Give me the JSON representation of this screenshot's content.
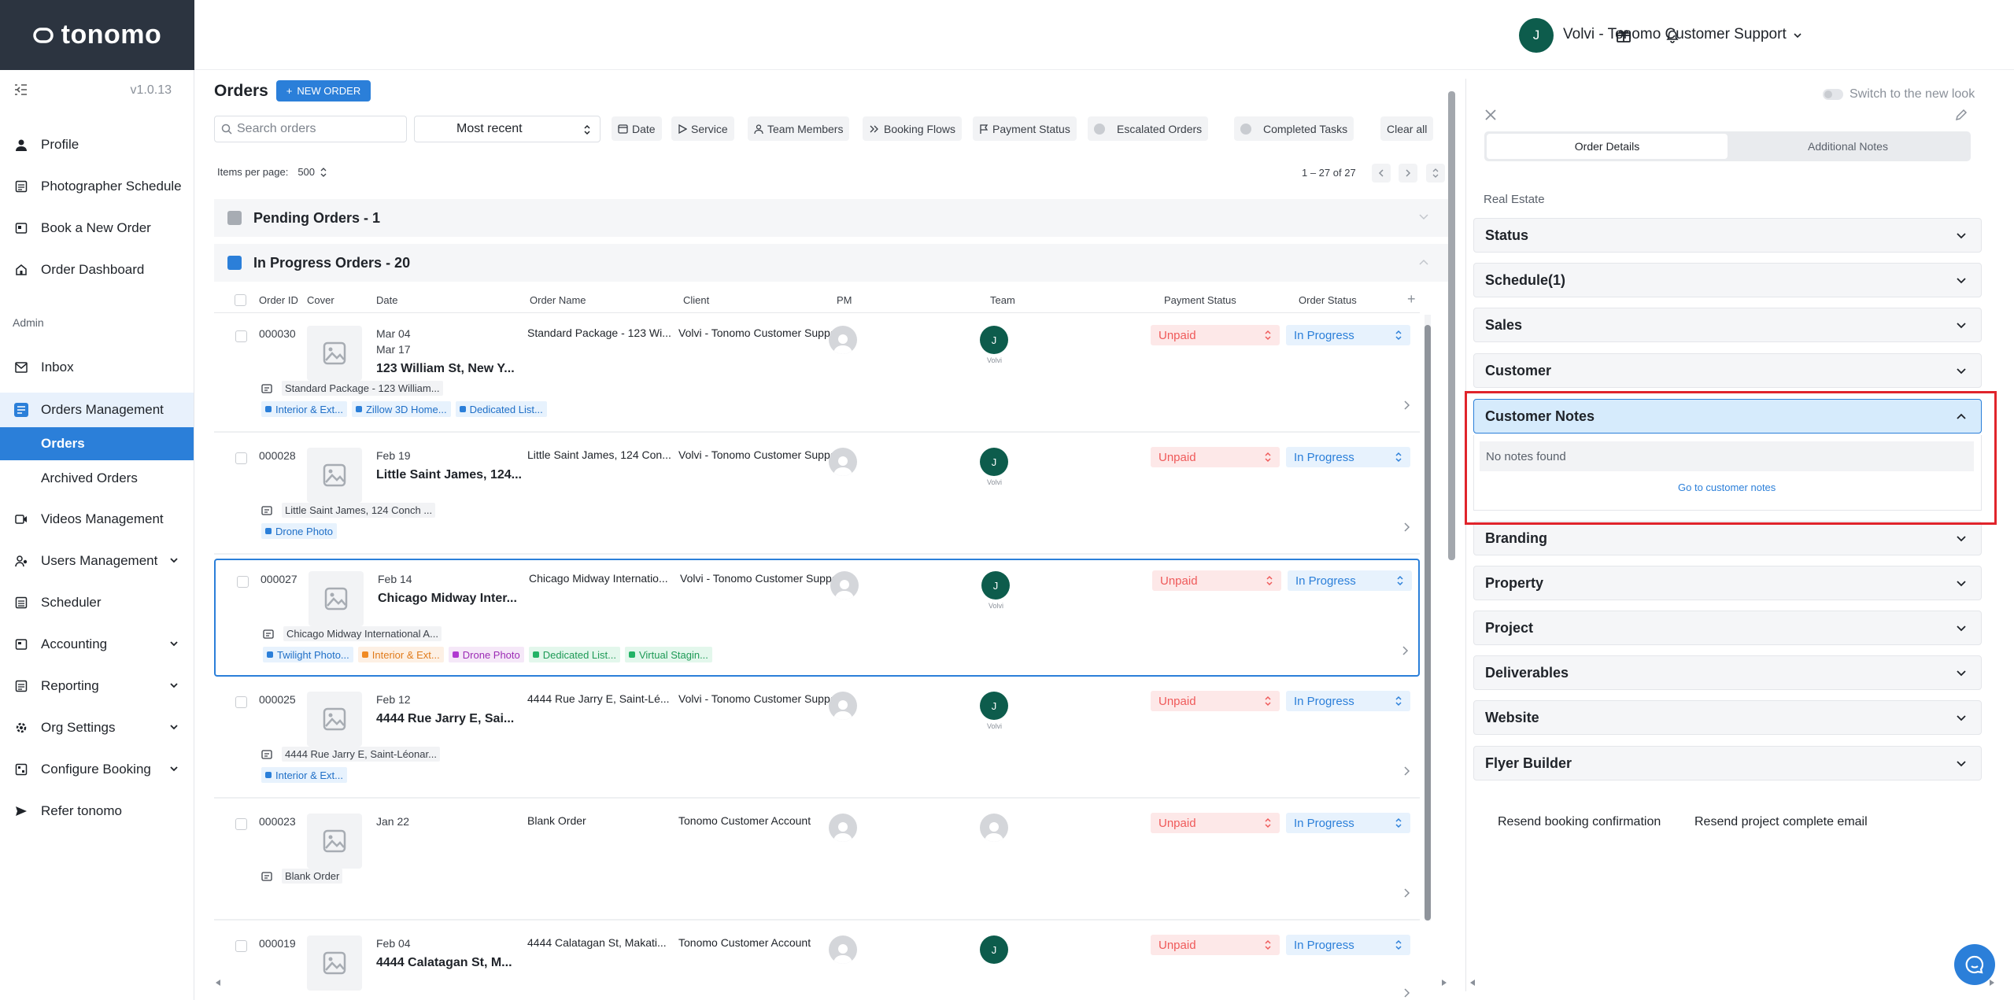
{
  "app": {
    "logo": "tonomo",
    "version": "v1.0.13"
  },
  "colors": {
    "brand_dark": "#2c3440",
    "accent": "#2b7fd9",
    "avatar_green": "#0d5c4c",
    "unpaid_red": "#ef5a5a",
    "highlight_red": "#e0242b"
  },
  "sidebar": {
    "items": [
      {
        "label": "Profile",
        "icon": "person-icon"
      },
      {
        "label": "Photographer Schedule",
        "icon": "schedule-icon"
      },
      {
        "label": "Book a New Order",
        "icon": "book-icon"
      },
      {
        "label": "Order Dashboard",
        "icon": "home-icon"
      }
    ],
    "admin_label": "Admin",
    "admin_items": [
      {
        "label": "Inbox",
        "icon": "mail-icon"
      },
      {
        "label": "Orders Management",
        "icon": "orders-icon"
      },
      {
        "label": "Videos Management",
        "icon": "video-icon"
      },
      {
        "label": "Users Management",
        "icon": "users-icon"
      },
      {
        "label": "Scheduler",
        "icon": "scheduler-icon"
      },
      {
        "label": "Accounting",
        "icon": "accounting-icon"
      },
      {
        "label": "Reporting",
        "icon": "reporting-icon"
      },
      {
        "label": "Org Settings",
        "icon": "gear-icon"
      },
      {
        "label": "Configure Booking",
        "icon": "booking-icon"
      },
      {
        "label": "Refer tonomo",
        "icon": "send-icon"
      }
    ],
    "sub_items": {
      "orders": "Orders",
      "archived": "Archived Orders"
    }
  },
  "topbar": {
    "user_initial": "J",
    "user_name": "Volvi - Tonomo Customer Support"
  },
  "orders": {
    "title": "Orders",
    "new_order_label": "NEW ORDER",
    "search_placeholder": "Search orders",
    "sort_value": "Most recent",
    "filters": [
      "Date",
      "Service",
      "Team Members",
      "Booking Flows",
      "Payment Status",
      "Escalated Orders",
      "Completed Tasks",
      "Clear all"
    ],
    "items_per_page_label": "Items per page:",
    "items_per_page_value": "500",
    "pager_range": "1 – 27 of 27",
    "sections": {
      "pending": "Pending Orders - 1",
      "in_progress": "In Progress Orders - 20"
    },
    "columns": [
      "Order ID",
      "Cover",
      "Date",
      "Order Name",
      "Client",
      "PM",
      "Team",
      "Payment Status",
      "Order Status"
    ],
    "rows": [
      {
        "id": "000030",
        "date1": "Mar 04",
        "date2": "Mar 17",
        "address": "123 William St, New Y...",
        "name": "Standard Package - 123 Wi...",
        "client": "Volvi - Tonomo Customer Support",
        "team_initial": "J",
        "team_label": "Volvi",
        "payment": "Unpaid",
        "status": "In Progress",
        "note": "Standard Package - 123 William...",
        "tags": [
          {
            "label": "Interior & Ext...",
            "color": "blue"
          },
          {
            "label": "Zillow 3D Home...",
            "color": "blue"
          },
          {
            "label": "Dedicated List...",
            "color": "blue"
          }
        ]
      },
      {
        "id": "000028",
        "date1": "Feb 19",
        "date2": "",
        "address": "Little Saint James, 124...",
        "name": "Little Saint James, 124 Con...",
        "client": "Volvi - Tonomo Customer Support",
        "team_initial": "J",
        "team_label": "Volvi",
        "payment": "Unpaid",
        "status": "In Progress",
        "note": "Little Saint James, 124 Conch ...",
        "tags": [
          {
            "label": "Drone Photo",
            "color": "blue"
          }
        ]
      },
      {
        "id": "000027",
        "date1": "Feb 14",
        "date2": "",
        "address": "Chicago Midway Inter...",
        "name": "Chicago Midway Internatio...",
        "client": "Volvi - Tonomo Customer Support",
        "team_initial": "J",
        "team_label": "Volvi",
        "payment": "Unpaid",
        "status": "In Progress",
        "note": "Chicago Midway International A...",
        "tags": [
          {
            "label": "Twilight Photo...",
            "color": "blue"
          },
          {
            "label": "Interior & Ext...",
            "color": "orange"
          },
          {
            "label": "Drone Photo",
            "color": "purple"
          },
          {
            "label": "Dedicated List...",
            "color": "green"
          },
          {
            "label": "Virtual Stagin...",
            "color": "green"
          }
        ]
      },
      {
        "id": "000025",
        "date1": "Feb 12",
        "date2": "",
        "address": "4444 Rue Jarry E, Sai...",
        "name": "4444 Rue Jarry E, Saint-Lé...",
        "client": "Volvi - Tonomo Customer Support",
        "team_initial": "J",
        "team_label": "Volvi",
        "payment": "Unpaid",
        "status": "In Progress",
        "note": "4444 Rue Jarry E, Saint-Léonar...",
        "tags": [
          {
            "label": "Interior & Ext...",
            "color": "blue"
          }
        ]
      },
      {
        "id": "000023",
        "date1": "Jan 22",
        "date2": "",
        "address": "",
        "name": "Blank Order",
        "client": "Tonomo Customer Account",
        "team_initial": "",
        "team_label": "",
        "payment": "Unpaid",
        "status": "In Progress",
        "note": "Blank Order",
        "tags": []
      },
      {
        "id": "000019",
        "date1": "Feb 04",
        "date2": "",
        "address": "4444 Calatagan St, M...",
        "name": "4444 Calatagan St, Makati...",
        "client": "Tonomo Customer Account",
        "team_initial": "J",
        "team_label": "",
        "payment": "Unpaid",
        "status": "In Progress",
        "note": "",
        "tags": []
      }
    ]
  },
  "details": {
    "switch_label": "Switch to the new look",
    "tabs": [
      "Order Details",
      "Additional Notes"
    ],
    "category": "Real Estate",
    "accordions": [
      "Status",
      "Schedule(1)",
      "Sales",
      "Customer",
      "Customer Notes",
      "Branding",
      "Property",
      "Project",
      "Deliverables",
      "Website",
      "Flyer Builder"
    ],
    "no_notes": "No notes found",
    "go_to_notes": "Go to customer notes",
    "resend_booking": "Resend booking confirmation",
    "resend_complete": "Resend project complete email"
  }
}
